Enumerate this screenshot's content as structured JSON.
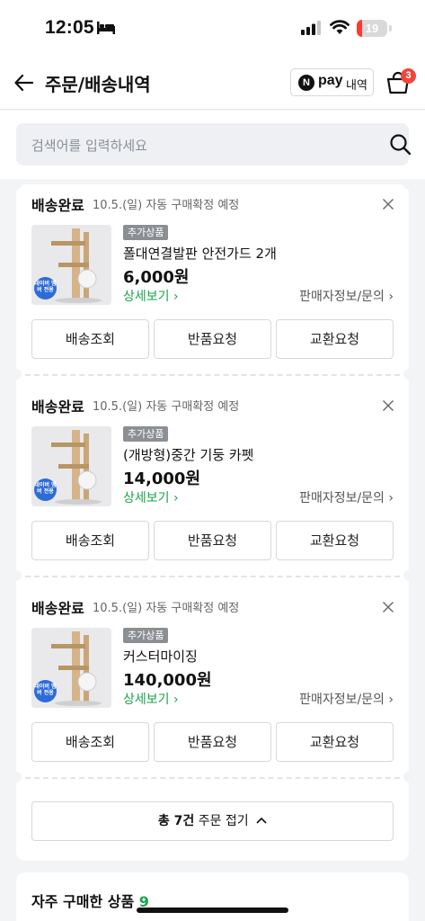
{
  "status_bar": {
    "time": "12:05",
    "battery": "19",
    "battery_level": 0.19
  },
  "header": {
    "title": "주문/배송내역",
    "npay_logo": "N",
    "npay_label": "pay",
    "npay_suffix": "내역",
    "cart_count": "3"
  },
  "search": {
    "placeholder": "검색어를 입력하세요"
  },
  "orders": [
    {
      "status": "배송완료",
      "detail": "10.5.(일) 자동 구매확정 예정",
      "tag": "추가상품",
      "thumb_badge": "네이버 멤버 전용",
      "name": "폴대연결발판 안전가드 2개",
      "price": "6,000원",
      "detail_link": "상세보기 ›",
      "seller_link": "판매자정보/문의 ›",
      "actions": [
        "배송조회",
        "반품요청",
        "교환요청"
      ]
    },
    {
      "status": "배송완료",
      "detail": "10.5.(일) 자동 구매확정 예정",
      "tag": "추가상품",
      "thumb_badge": "네이버 멤버 전용",
      "name": "(개방형)중간 기둥 카펫",
      "price": "14,000원",
      "detail_link": "상세보기 ›",
      "seller_link": "판매자정보/문의 ›",
      "actions": [
        "배송조회",
        "반품요청",
        "교환요청"
      ]
    },
    {
      "status": "배송완료",
      "detail": "10.5.(일) 자동 구매확정 예정",
      "tag": "추가상품",
      "thumb_badge": "네이버 멤버 전용",
      "name": "커스터마이징",
      "price": "140,000원",
      "detail_link": "상세보기 ›",
      "seller_link": "판매자정보/문의 ›",
      "actions": [
        "배송조회",
        "반품요청",
        "교환요청"
      ]
    }
  ],
  "collapse": {
    "count_text": "총 7건",
    "label": "주문 접기"
  },
  "frequent": {
    "title": "자주 구매한 상품",
    "count": "9"
  },
  "colors": {
    "accent_green": "#17a34a",
    "badge_red": "#f0463c"
  }
}
